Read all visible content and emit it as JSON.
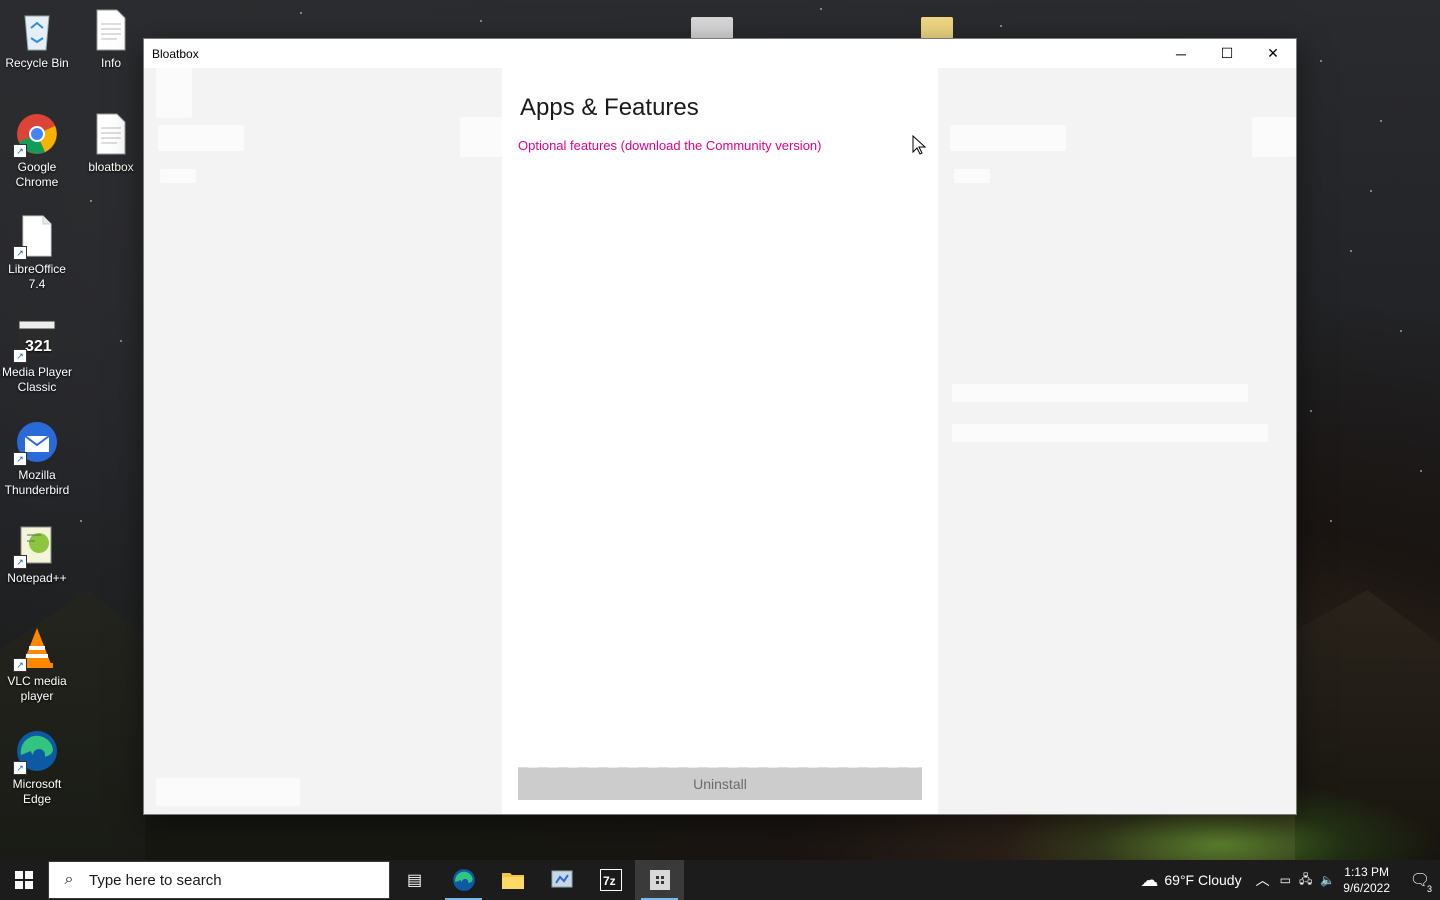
{
  "desktop": {
    "icons": [
      {
        "label": "Recycle Bin",
        "icon": "recycle-bin-icon"
      },
      {
        "label": "Info",
        "icon": "text-file-icon"
      },
      {
        "label": "Google Chrome",
        "icon": "chrome-icon"
      },
      {
        "label": "bloatbox",
        "icon": "text-file-icon"
      },
      {
        "label": "LibreOffice 7.4",
        "icon": "libreoffice-icon"
      },
      {
        "label": "Media Player Classic",
        "icon": "media-player-icon"
      },
      {
        "label": "Mozilla Thunderbird",
        "icon": "thunderbird-icon"
      },
      {
        "label": "Notepad++",
        "icon": "notepadpp-icon"
      },
      {
        "label": "VLC media player",
        "icon": "vlc-icon"
      },
      {
        "label": "Microsoft Edge",
        "icon": "edge-icon"
      }
    ]
  },
  "window": {
    "title": "Bloatbox",
    "controls": {
      "minimize": "─",
      "maximize": "☐",
      "close": "✕"
    }
  },
  "main": {
    "heading": "Apps & Features",
    "optional_link": "Optional features (download the Community version)",
    "uninstall_label": "Uninstall"
  },
  "taskbar": {
    "search_placeholder": "Type here to search",
    "weather": "69°F  Cloudy",
    "time": "1:13 PM",
    "date": "9/6/2022",
    "notification_count": "3"
  },
  "colors": {
    "link": "#e3008c",
    "taskbar": "#1c1c1c",
    "active_indicator": "#76b9ed"
  }
}
